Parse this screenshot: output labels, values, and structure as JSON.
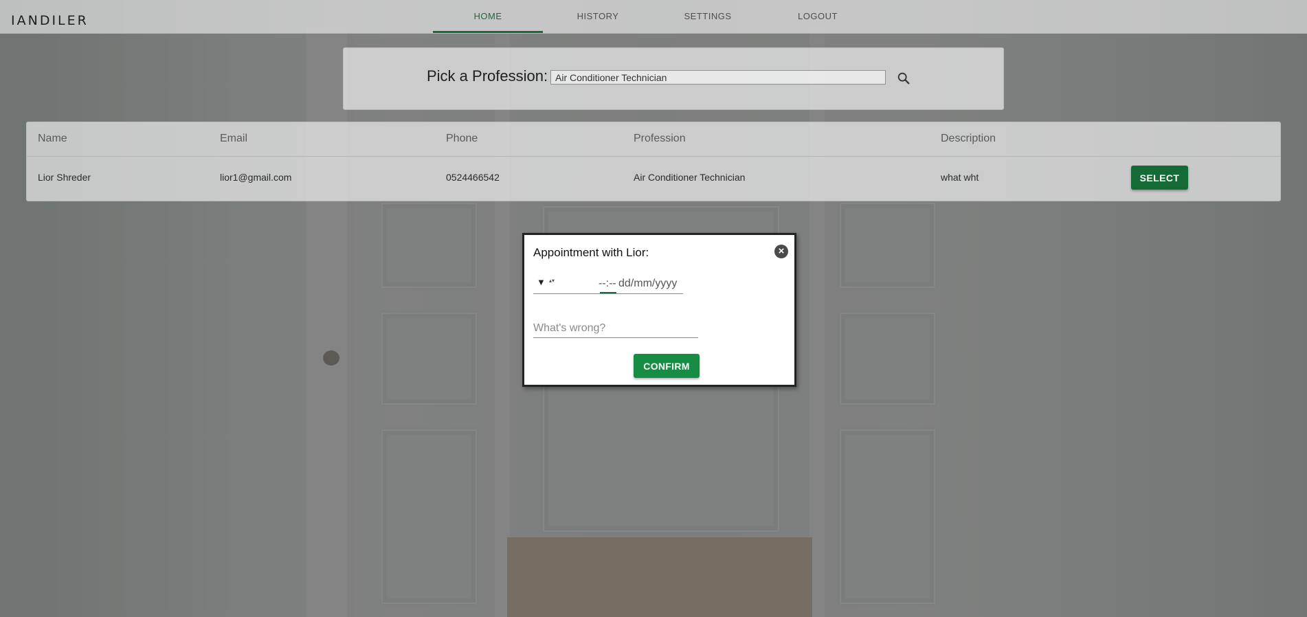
{
  "app": {
    "logo": "IANDILER"
  },
  "nav": {
    "items": [
      {
        "label": "HOME",
        "active": true
      },
      {
        "label": "HISTORY",
        "active": false
      },
      {
        "label": "SETTINGS",
        "active": false
      },
      {
        "label": "LOGOUT",
        "active": false
      }
    ]
  },
  "search": {
    "label": "Pick a Profession:",
    "value": "Air Conditioner Technician",
    "icon": "search-icon"
  },
  "table": {
    "columns": [
      "Name",
      "Email",
      "Phone",
      "Profession",
      "Description"
    ],
    "rows": [
      {
        "name": "Lior Shreder",
        "email": "lior1@gmail.com",
        "phone": "0524466542",
        "profession": "Air Conditioner Technician",
        "description": "what wht",
        "action": "SELECT"
      }
    ]
  },
  "modal": {
    "title": "Appointment with Lior:",
    "close_icon": "close-icon",
    "datetime": {
      "arrow": "▼",
      "spinner": "▴▾",
      "time_placeholder": "--:--",
      "date_placeholder": "dd/mm/yyyy"
    },
    "problem_placeholder": "What's wrong?",
    "confirm_label": "CONFIRM"
  },
  "colors": {
    "primary_dark": "#146b36",
    "primary": "#168c45",
    "active_nav": "#1b6b3a"
  }
}
